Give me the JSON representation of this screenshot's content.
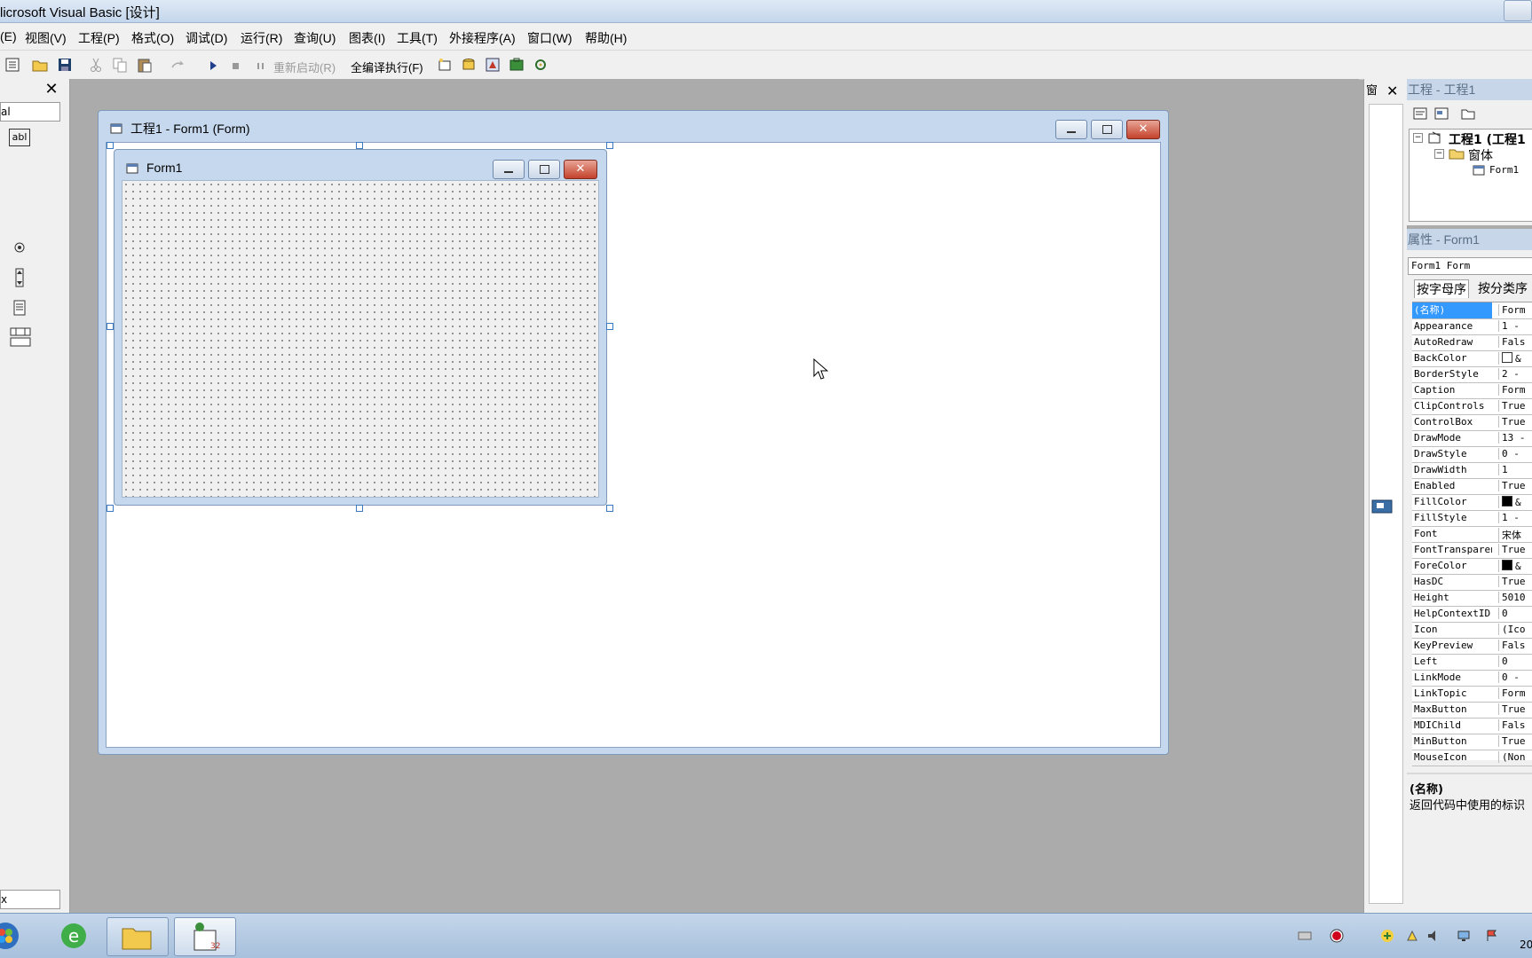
{
  "app": {
    "title": "licrosoft Visual Basic [设计]"
  },
  "menu": [
    "(E)",
    "视图(V)",
    "工程(P)",
    "格式(O)",
    "调试(D)",
    "运行(R)",
    "查询(U)",
    "图表(I)",
    "工具(T)",
    "外接程序(A)",
    "窗口(W)",
    "帮助(H)"
  ],
  "toolbar": {
    "restart_label": "重新启动(R)",
    "full_compile_label": "全编译执行(F)"
  },
  "toolbox": {
    "header": "al",
    "footer": "x",
    "textbox_label": "abl"
  },
  "designer": {
    "title": "工程1 - Form1 (Form)"
  },
  "form1": {
    "title": "Form1"
  },
  "right_strip": {
    "label": "窗"
  },
  "project": {
    "title": "工程 - 工程1",
    "tree": {
      "root": "工程1 (工程1",
      "folder": "窗体",
      "item": "Form1"
    }
  },
  "properties": {
    "title": "属性 - Form1",
    "object": "Form1 Form",
    "tabs": [
      "按字母序",
      "按分类序"
    ],
    "rows": [
      {
        "name": "(名称)",
        "value": "Form"
      },
      {
        "name": "Appearance",
        "value": "1 -"
      },
      {
        "name": "AutoRedraw",
        "value": "Fals"
      },
      {
        "name": "BackColor",
        "value": "&"
      },
      {
        "name": "BorderStyle",
        "value": "2 -"
      },
      {
        "name": "Caption",
        "value": "Form"
      },
      {
        "name": "ClipControls",
        "value": "True"
      },
      {
        "name": "ControlBox",
        "value": "True"
      },
      {
        "name": "DrawMode",
        "value": "13 -"
      },
      {
        "name": "DrawStyle",
        "value": "0 -"
      },
      {
        "name": "DrawWidth",
        "value": "1"
      },
      {
        "name": "Enabled",
        "value": "True"
      },
      {
        "name": "FillColor",
        "value": "&"
      },
      {
        "name": "FillStyle",
        "value": "1 -"
      },
      {
        "name": "Font",
        "value": "宋体"
      },
      {
        "name": "FontTransparent",
        "value": "True"
      },
      {
        "name": "ForeColor",
        "value": "&"
      },
      {
        "name": "HasDC",
        "value": "True"
      },
      {
        "name": "Height",
        "value": "5010"
      },
      {
        "name": "HelpContextID",
        "value": "0"
      },
      {
        "name": "Icon",
        "value": "(Ico"
      },
      {
        "name": "KeyPreview",
        "value": "Fals"
      },
      {
        "name": "Left",
        "value": "0"
      },
      {
        "name": "LinkMode",
        "value": "0 -"
      },
      {
        "name": "LinkTopic",
        "value": "Form"
      },
      {
        "name": "MaxButton",
        "value": "True"
      },
      {
        "name": "MDIChild",
        "value": "Fals"
      },
      {
        "name": "MinButton",
        "value": "True"
      },
      {
        "name": "MouseIcon",
        "value": "(Non"
      }
    ],
    "desc_title": "(名称)",
    "desc_text": "返回代码中使用的标识"
  },
  "taskbar": {
    "clock": "20"
  },
  "colors": {
    "selection": "#3399ff",
    "mdi_background": "#ababab",
    "handle": "#3a78c2",
    "close": "#c4422c"
  }
}
